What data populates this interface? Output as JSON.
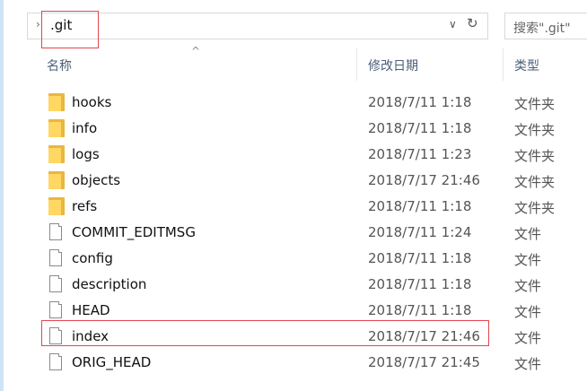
{
  "address": {
    "chevron": "›",
    "path": ".git",
    "dropdown_glyph": "∨",
    "refresh_glyph": "↻"
  },
  "search": {
    "placeholder": "搜索\".git\""
  },
  "columns": {
    "name": "名称",
    "date": "修改日期",
    "type": "类型",
    "sort_glyph": "^"
  },
  "files": [
    {
      "name": "hooks",
      "date": "2018/7/11 1:18",
      "type": "文件夹",
      "icon": "folder-icon"
    },
    {
      "name": "info",
      "date": "2018/7/11 1:18",
      "type": "文件夹",
      "icon": "folder-icon"
    },
    {
      "name": "logs",
      "date": "2018/7/11 1:23",
      "type": "文件夹",
      "icon": "folder-icon"
    },
    {
      "name": "objects",
      "date": "2018/7/17 21:46",
      "type": "文件夹",
      "icon": "folder-icon"
    },
    {
      "name": "refs",
      "date": "2018/7/11 1:18",
      "type": "文件夹",
      "icon": "folder-icon"
    },
    {
      "name": "COMMIT_EDITMSG",
      "date": "2018/7/11 1:24",
      "type": "文件",
      "icon": "file-icon"
    },
    {
      "name": "config",
      "date": "2018/7/11 1:18",
      "type": "文件",
      "icon": "file-icon"
    },
    {
      "name": "description",
      "date": "2018/7/11 1:18",
      "type": "文件",
      "icon": "file-icon"
    },
    {
      "name": "HEAD",
      "date": "2018/7/11 1:18",
      "type": "文件",
      "icon": "file-icon"
    },
    {
      "name": "index",
      "date": "2018/7/17 21:46",
      "type": "文件",
      "icon": "file-icon"
    },
    {
      "name": "ORIG_HEAD",
      "date": "2018/7/17 21:45",
      "type": "文件",
      "icon": "file-icon"
    }
  ],
  "colors": {
    "highlight": "#e0464e",
    "folder": "#ffd762",
    "header_text": "#4a5f78"
  }
}
